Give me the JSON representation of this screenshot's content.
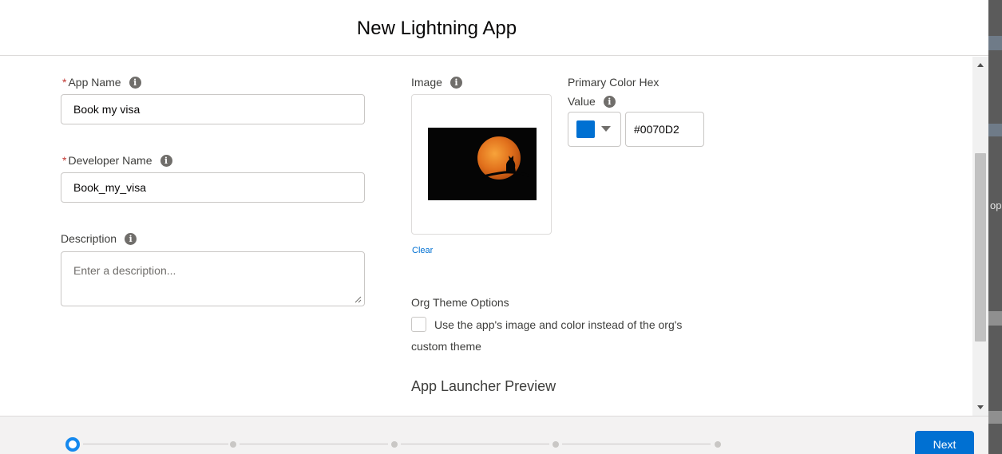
{
  "modal": {
    "title": "New Lightning App"
  },
  "form": {
    "app_name": {
      "required_mark": "*",
      "label": "App Name",
      "value": "Book my visa"
    },
    "developer_name": {
      "required_mark": "*",
      "label": "Developer Name",
      "value": "Book_my_visa"
    },
    "description": {
      "label": "Description",
      "placeholder": "Enter a description..."
    },
    "image": {
      "label": "Image",
      "clear_label": "Clear"
    },
    "primary_color": {
      "label_line1": "Primary Color Hex",
      "label_line2": "Value",
      "value": "#0070D2",
      "swatch_color": "#0070D2"
    },
    "org_theme": {
      "label": "Org Theme Options",
      "checkbox_checked": false,
      "checkbox_label_line1": "Use the app's image and color instead of the org's",
      "checkbox_label_line2": "custom theme"
    },
    "preview_heading": "App Launcher Preview",
    "info_glyph": "i"
  },
  "footer": {
    "steps_total": 5,
    "current_step": 1,
    "next_label": "Next"
  },
  "backdrop": {
    "partial_text": "op"
  },
  "colors": {
    "brand": "#0070D2",
    "active_step": "#1589EE",
    "required": "#C23934"
  }
}
